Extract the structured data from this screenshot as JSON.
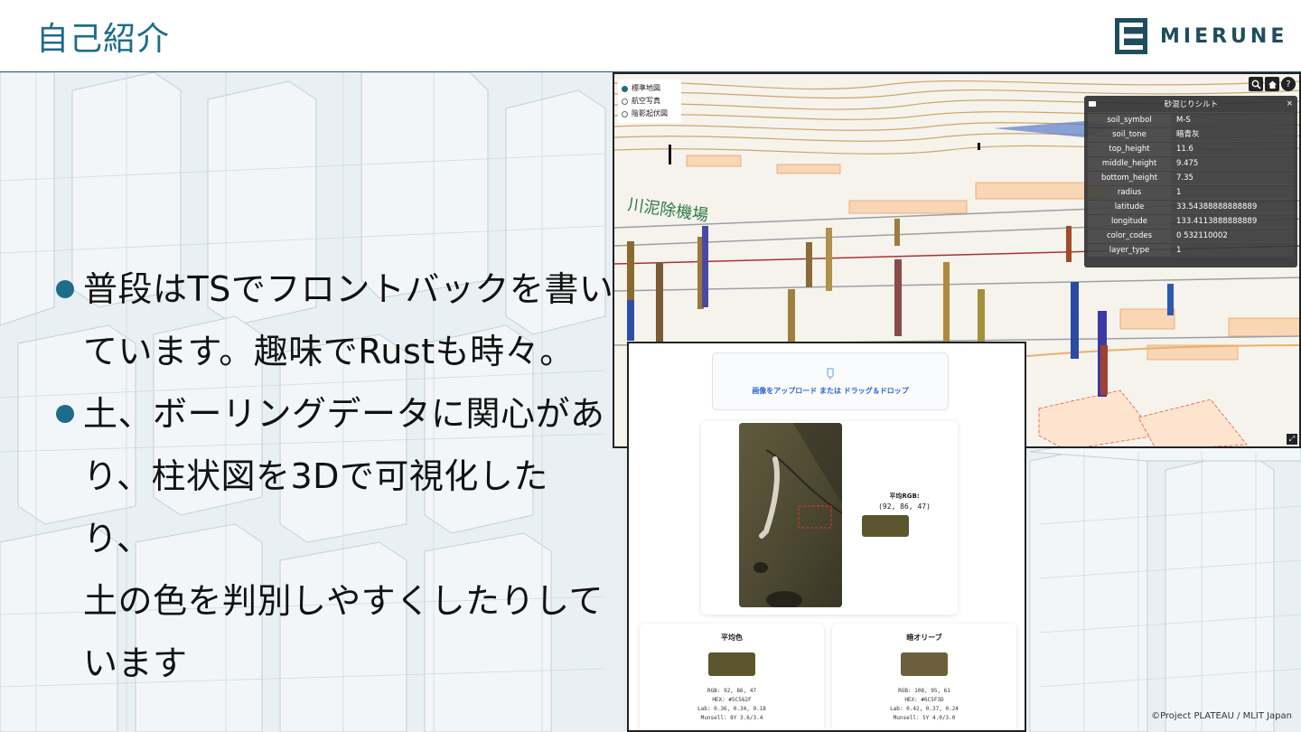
{
  "header": {
    "title": "自己紹介",
    "logo_text": "MIERUNE"
  },
  "bullets": [
    {
      "lines": [
        "普段はTSでフロントバックを書い",
        "ています。趣味でRustも時々。"
      ]
    },
    {
      "lines": [
        "土、ボーリングデータに関心があ",
        "り、柱状図を3Dで可視化したり、",
        "土の色を判別しやすくしたりして",
        "います"
      ]
    }
  ],
  "map": {
    "layers": [
      {
        "label": "標準地図",
        "selected": true
      },
      {
        "label": "航空写真",
        "selected": false
      },
      {
        "label": "陰影起伏図",
        "selected": false
      }
    ],
    "tools": [
      "search-icon",
      "home-icon",
      "help-icon"
    ],
    "info_panel": {
      "title": "砂混じりシルト",
      "close": "×",
      "rows": [
        {
          "key": "soil_symbol",
          "value": "M-S"
        },
        {
          "key": "soil_tone",
          "value": "暗青灰"
        },
        {
          "key": "top_height",
          "value": "11.6"
        },
        {
          "key": "middle_height",
          "value": "9.475"
        },
        {
          "key": "bottom_height",
          "value": "7.35"
        },
        {
          "key": "radius",
          "value": "1"
        },
        {
          "key": "latitude",
          "value": "33.54388888888889"
        },
        {
          "key": "longitude",
          "value": "133.4113888888889"
        },
        {
          "key": "color_codes",
          "value": "0   532110002"
        },
        {
          "key": "layer_type",
          "value": "1"
        }
      ]
    }
  },
  "app": {
    "upload_label": "画像をアップロード または ドラッグ＆ドロップ",
    "avg_label": "平均RGB:",
    "avg_rgb": "(92, 86, 47)",
    "avg_color": "#5C562F",
    "cards": [
      {
        "title": "平均色",
        "color": "#5C562F",
        "rgb": "RGB: 92, 86, 47",
        "hex": "HEX: #5C562F",
        "lab": "Lab: 0.36, 0.34, 0.18",
        "munsell": "Munsell: 8Y 3.6/3.4"
      },
      {
        "title": "暗オリーブ",
        "color": "#6C5F3D",
        "rgb": "RGB: 108, 95, 61",
        "hex": "HEX: #6C5F3D",
        "lab": "Lab: 0.42, 0.37, 0.24",
        "munsell": "Munsell: 5Y 4.0/3.0"
      }
    ]
  },
  "credit": "©Project PLATEAU / MLIT Japan",
  "colors": {
    "accent": "#1e6b8a",
    "logo": "#1e4e5e"
  }
}
